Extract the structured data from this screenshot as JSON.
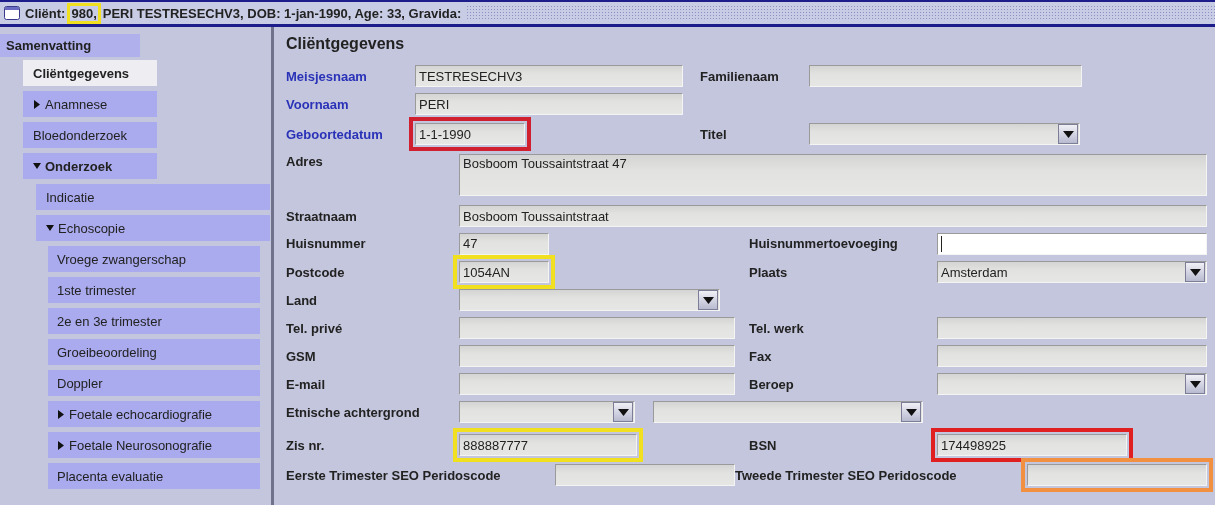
{
  "title_bar": {
    "parts": [
      {
        "text": "Cliënt:"
      },
      {
        "text": "980,",
        "color": "#f0e020"
      },
      {
        "text": "PERI TESTRESECHV3, DOB: 1-jan-1990, Age: 33, Gravida:"
      }
    ]
  },
  "sidebar": {
    "header": "Samenvatting",
    "items": [
      {
        "label": "Cliëntgegevens",
        "selected": true,
        "bold": true
      },
      {
        "label": "Anamnese",
        "selected": false,
        "bold": false,
        "expanded": false
      },
      {
        "label": "Bloedonderzoek",
        "selected": false,
        "bold": false
      },
      {
        "label": "Onderzoek",
        "selected": false,
        "bold": true,
        "expanded": true,
        "children": [
          {
            "label": "Indicatie",
            "selected": false,
            "bold": false
          },
          {
            "label": "Echoscopie",
            "selected": false,
            "bold": false,
            "expanded": true,
            "children": [
              {
                "label": "Vroege zwangerschap",
                "selected": false,
                "bold": false
              },
              {
                "label": "1ste trimester",
                "selected": false,
                "bold": false
              },
              {
                "label": "2e en 3e trimester",
                "selected": false,
                "bold": false
              },
              {
                "label": "Groeibeoordeling",
                "selected": false,
                "bold": false
              },
              {
                "label": "Doppler",
                "selected": false,
                "bold": false
              },
              {
                "label": "Foetale echocardiografie",
                "selected": false,
                "bold": false,
                "expanded": false
              },
              {
                "label": "Foetale Neurosonografie",
                "selected": false,
                "bold": false,
                "expanded": false
              },
              {
                "label": "Placenta evaluatie",
                "selected": false,
                "bold": false
              }
            ]
          }
        ]
      }
    ]
  },
  "form": {
    "title": "Cliëntgegevens",
    "rows": [
      {
        "fields": [
          {
            "label": "Meisjesnaam",
            "required": true,
            "kind": "text",
            "value": "TESTRESECHV3",
            "focused": false
          },
          {
            "label": "Familienaam",
            "required": false,
            "kind": "text",
            "focused": false
          }
        ]
      },
      {
        "fields": [
          {
            "label": "Voornaam",
            "required": true,
            "kind": "text",
            "value": "PERI",
            "focused": false
          }
        ]
      },
      {
        "fields": [
          {
            "label": "Geboortedatum",
            "required": true,
            "kind": "text",
            "value": "1-1-1990",
            "focused": false,
            "color": "#d02030"
          },
          {
            "label": "Titel",
            "required": false,
            "kind": "combo",
            "focused": false
          }
        ]
      },
      {
        "fields": [
          {
            "label": "Adres",
            "required": false,
            "kind": "area",
            "value": "Bosboom Toussaintstraat 47",
            "focused": false
          }
        ]
      },
      {
        "fields": [
          {
            "label": "Straatnaam",
            "required": false,
            "kind": "text",
            "value": "Bosboom Toussaintstraat",
            "focused": false
          }
        ]
      },
      {
        "fields": [
          {
            "label": "Huisnummer",
            "required": false,
            "kind": "text",
            "value": "47",
            "focused": false
          },
          {
            "label": "Huisnummertoevoeging",
            "required": false,
            "kind": "text",
            "focused": true
          }
        ]
      },
      {
        "fields": [
          {
            "label": "Postcode",
            "required": false,
            "kind": "text",
            "value": "1054AN",
            "focused": false,
            "color": "#f0e020"
          },
          {
            "label": "Plaats",
            "required": false,
            "kind": "combo",
            "value": "Amsterdam",
            "focused": false
          }
        ]
      },
      {
        "fields": [
          {
            "label": "Land",
            "required": false,
            "kind": "combo",
            "focused": false
          }
        ]
      },
      {
        "fields": [
          {
            "label": "Tel. privé",
            "required": false,
            "kind": "text",
            "focused": false
          },
          {
            "label": "Tel. werk",
            "required": false,
            "kind": "text",
            "focused": false
          }
        ]
      },
      {
        "fields": [
          {
            "label": "GSM",
            "required": false,
            "kind": "text",
            "focused": false
          },
          {
            "label": "Fax",
            "required": false,
            "kind": "text",
            "focused": false
          }
        ]
      },
      {
        "fields": [
          {
            "label": "E-mail",
            "required": false,
            "kind": "text",
            "focused": false
          },
          {
            "label": "Beroep",
            "required": false,
            "kind": "combo",
            "focused": false
          }
        ]
      },
      {
        "fields": [
          {
            "label": "Etnische achtergrond",
            "required": false,
            "kind": "combo",
            "focused": false
          },
          {
            "kind": "combo",
            "focused": false
          }
        ]
      },
      {
        "fields": [
          {
            "label": "Zis nr.",
            "required": false,
            "kind": "text",
            "value": "888887777",
            "focused": false,
            "color": "#f0e020"
          },
          {
            "label": "BSN",
            "required": false,
            "kind": "text",
            "value": "174498925",
            "focused": false,
            "color": "#e02020"
          }
        ]
      },
      {
        "fields": [
          {
            "label": "Eerste Trimester SEO Peridoscode",
            "required": false,
            "kind": "text",
            "focused": false
          },
          {
            "label": "Tweede Trimester SEO Peridoscode",
            "required": false,
            "kind": "text",
            "focused": false,
            "color": "#f09040"
          }
        ]
      }
    ]
  }
}
